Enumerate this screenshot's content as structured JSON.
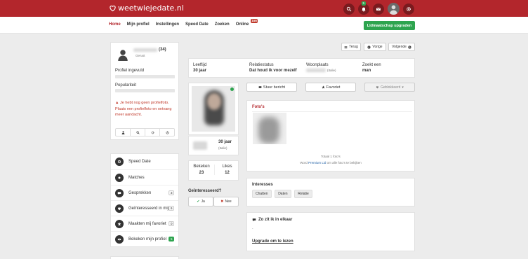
{
  "header": {
    "logo_text": "weetwiejedate.nl",
    "notif_badge": "5",
    "colors": {
      "brand": "#b3262c",
      "accent_green": "#2ea44f"
    }
  },
  "nav": {
    "items": [
      "Home",
      "Mijn profiel",
      "Instellingen",
      "Speed Date",
      "Zoeken",
      "Online"
    ],
    "online_count": "155",
    "upgrade_label": "Lidmaatschap upgraden"
  },
  "sidebar": {
    "profile_age": "(34)",
    "profile_status": "Gerust",
    "completion_label": "Profiel ingevuld",
    "popularity_label": "Populariteit",
    "warning_text": "Je hebt nog geen profielfoto. Plaats een profielfoto en ontvang meer aandacht.",
    "menu": [
      {
        "label": "Speed Date",
        "icon": "speed-date-icon",
        "count": ""
      },
      {
        "label": "Matches",
        "icon": "matches-icon",
        "count": ""
      },
      {
        "label": "Gesprekken",
        "icon": "chat-icon",
        "count": "3"
      },
      {
        "label": "Geïnteresseerd in mij",
        "icon": "heart-icon",
        "count": "6"
      },
      {
        "label": "Maakten mij favoriet",
        "icon": "star-icon",
        "count": "0"
      },
      {
        "label": "Bekeken mijn profiel",
        "icon": "eye-icon",
        "count": "5"
      }
    ]
  },
  "profile_nav": {
    "back_label": "Terug",
    "prev_label": "Vorige",
    "next_label": "Volgende"
  },
  "info_row": {
    "age_label": "Leeftijd",
    "age_value": "30 jaar",
    "relation_label": "Relatiestatus",
    "relation_value": "Dat houd ik voor mezelf",
    "residence_label": "Woonplaats",
    "residence_suffix": "(Italie)",
    "seeking_label": "Zoekt een",
    "seeking_value": "man"
  },
  "profile_card": {
    "age": "30 jaar",
    "location_suffix": "(Italie)",
    "viewed_label": "Bekeken",
    "viewed_value": "23",
    "likes_label": "Likes",
    "likes_value": "12",
    "interested_label": "Geïnteresseerd?",
    "yes_label": "Ja",
    "no_label": "Nee"
  },
  "actions": {
    "message_label": "Stuur bericht",
    "favorite_label": "Favoriet",
    "blocked_label": "Geblokkeerd"
  },
  "photos": {
    "title": "Foto's",
    "total": "Totaal 1 foto's",
    "premium_prefix": "Word",
    "premium_link": "Premium Lid",
    "premium_suffix": "om alle foto's te bekijken"
  },
  "interests": {
    "title": "Interesses",
    "tags": [
      "Chatten",
      "Daten",
      "Relatie"
    ]
  },
  "compat": {
    "title": "Zo zit ik in elkaar",
    "dash": "-",
    "upgrade_link": "Upgrade om te lezen"
  }
}
